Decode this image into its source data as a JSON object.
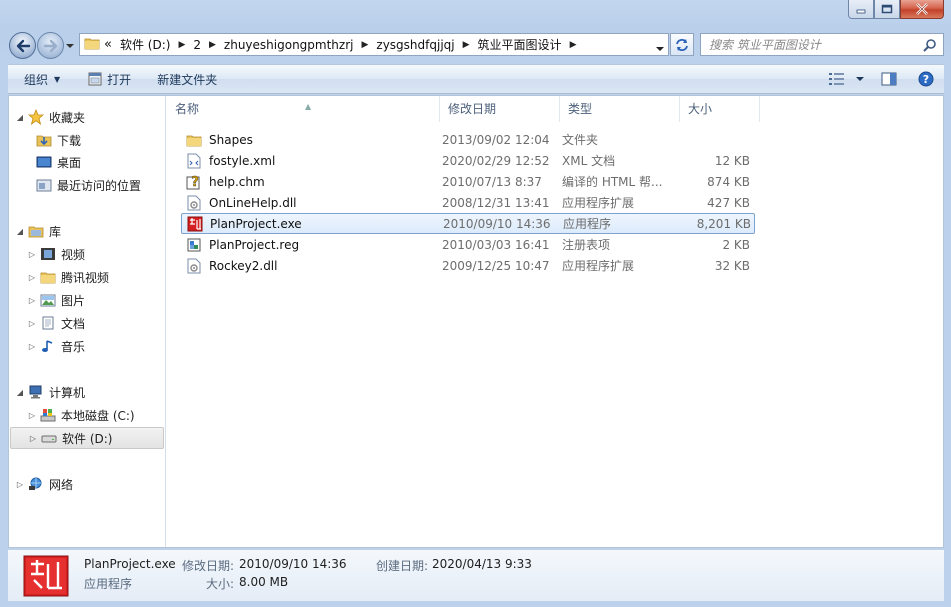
{
  "window": {
    "caption_buttons": [
      {
        "name": "minimize",
        "icon": "minimize-icon"
      },
      {
        "name": "maximize",
        "icon": "maximize-icon"
      },
      {
        "name": "close",
        "icon": "close-icon"
      }
    ]
  },
  "address": {
    "overflow": "«",
    "crumbs": [
      "软件 (D:)",
      "2",
      "zhuyeshigongpmthzrj",
      "zysgshdfqjjqj",
      "筑业平面图设计"
    ],
    "search_placeholder": "搜索 筑业平面图设计"
  },
  "toolbar": {
    "organize": "组织",
    "open": "打开",
    "new_folder": "新建文件夹"
  },
  "nav": {
    "favorites": "收藏夹",
    "downloads": "下载",
    "desktop": "桌面",
    "recent": "最近访问的位置",
    "libraries": "库",
    "videos": "视频",
    "tencent_video": "腾讯视频",
    "pictures": "图片",
    "documents": "文档",
    "music": "音乐",
    "computer": "计算机",
    "local_c": "本地磁盘 (C:)",
    "soft_d": "软件 (D:)",
    "network": "网络"
  },
  "columns": {
    "name": "名称",
    "date": "修改日期",
    "type": "类型",
    "size": "大小"
  },
  "files": [
    {
      "name": "Shapes",
      "date": "2013/09/02 12:04",
      "type": "文件夹",
      "size": "",
      "icon": "folder-icon"
    },
    {
      "name": "fostyle.xml",
      "date": "2020/02/29 12:52",
      "type": "XML 文档",
      "size": "12 KB",
      "icon": "xml-file-icon"
    },
    {
      "name": "help.chm",
      "date": "2010/07/13 8:37",
      "type": "编译的 HTML 帮...",
      "size": "874 KB",
      "icon": "help-file-icon"
    },
    {
      "name": "OnLineHelp.dll",
      "date": "2008/12/31 13:41",
      "type": "应用程序扩展",
      "size": "427 KB",
      "icon": "dll-file-icon"
    },
    {
      "name": "PlanProject.exe",
      "date": "2010/09/10 14:36",
      "type": "应用程序",
      "size": "8,201 KB",
      "icon": "app-icon",
      "selected": true
    },
    {
      "name": "PlanProject.reg",
      "date": "2010/03/03 16:41",
      "type": "注册表项",
      "size": "2 KB",
      "icon": "reg-file-icon"
    },
    {
      "name": "Rockey2.dll",
      "date": "2009/12/25 10:47",
      "type": "应用程序扩展",
      "size": "32 KB",
      "icon": "dll-file-icon"
    }
  ],
  "details": {
    "filename": "PlanProject.exe",
    "filetype": "应用程序",
    "modified_label": "修改日期:",
    "modified_value": "2010/09/10 14:36",
    "size_label": "大小:",
    "size_value": "8.00 MB",
    "created_label": "创建日期:",
    "created_value": "2020/04/13 9:33"
  },
  "colors": {
    "selection_border": "#7da2ce",
    "frame": "#bcd1eb",
    "app_icon_red": "#d42020"
  }
}
